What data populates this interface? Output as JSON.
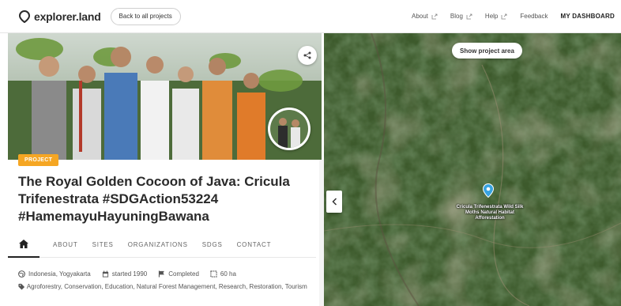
{
  "app": {
    "logo_text": "explorer.land",
    "back_label": "Back to all projects"
  },
  "nav": {
    "about": "About",
    "blog": "Blog",
    "help": "Help",
    "feedback": "Feedback",
    "dashboard": "MY DASHBOARD"
  },
  "project": {
    "badge": "PROJECT",
    "title": "The Royal Golden Cocoon of Java: Cricula Trifenestrata #SDGAction53224 #HamemayuHayuningBawana",
    "tabs": [
      "ABOUT",
      "SITES",
      "ORGANIZATIONS",
      "SDGS",
      "CONTACT"
    ],
    "location": "Indonesia, Yogyakarta",
    "started": "started 1990",
    "status": "Completed",
    "area": "60 ha",
    "categories": "Agroforestry, Conservation, Education, Natural Forest Management, Research, Restoration, Tourism"
  },
  "map": {
    "show_area_label": "Show project area",
    "marker_label": "Cricula Trifenestrata Wild Silk Moths Natural Habitat Afforestation"
  },
  "icons": {
    "logo": "map-pin-icon",
    "external": "external-link-icon",
    "share": "share-icon",
    "home": "home-icon",
    "location": "globe-icon",
    "calendar": "calendar-icon",
    "flag": "flag-icon",
    "area": "area-icon",
    "tag": "tag-icon",
    "collapse": "chevron-left-icon",
    "marker": "map-marker-icon"
  },
  "colors": {
    "badge": "#f5a623",
    "marker": "#38a3e0"
  }
}
